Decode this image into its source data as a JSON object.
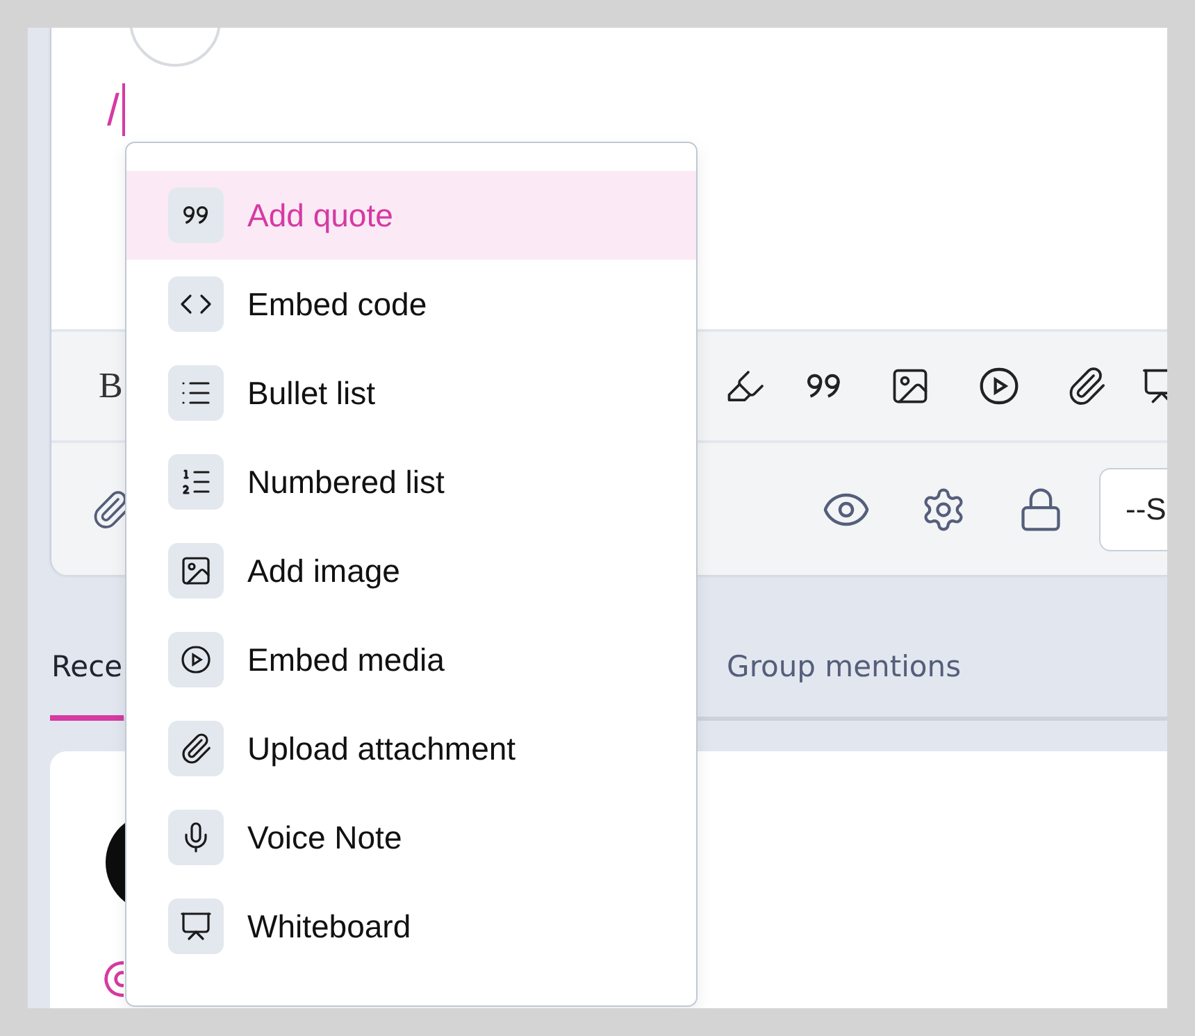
{
  "editor": {
    "typed_text": "/",
    "format_label": "B",
    "visibility_select": {
      "value": "--S"
    }
  },
  "slash_menu": {
    "items": [
      {
        "kind": "quote",
        "label": "Add quote",
        "selected": true
      },
      {
        "kind": "code",
        "label": "Embed code",
        "selected": false
      },
      {
        "kind": "bullets",
        "label": "Bullet list",
        "selected": false
      },
      {
        "kind": "numbers",
        "label": "Numbered list",
        "selected": false
      },
      {
        "kind": "image",
        "label": "Add image",
        "selected": false
      },
      {
        "kind": "media",
        "label": "Embed media",
        "selected": false
      },
      {
        "kind": "attachment",
        "label": "Upload attachment",
        "selected": false
      },
      {
        "kind": "voice",
        "label": "Voice Note",
        "selected": false
      },
      {
        "kind": "whiteboard",
        "label": "Whiteboard",
        "selected": false
      }
    ]
  },
  "tabs": [
    {
      "label": "Rece",
      "selected": true
    },
    {
      "label": "Group mentions",
      "selected": false
    }
  ]
}
